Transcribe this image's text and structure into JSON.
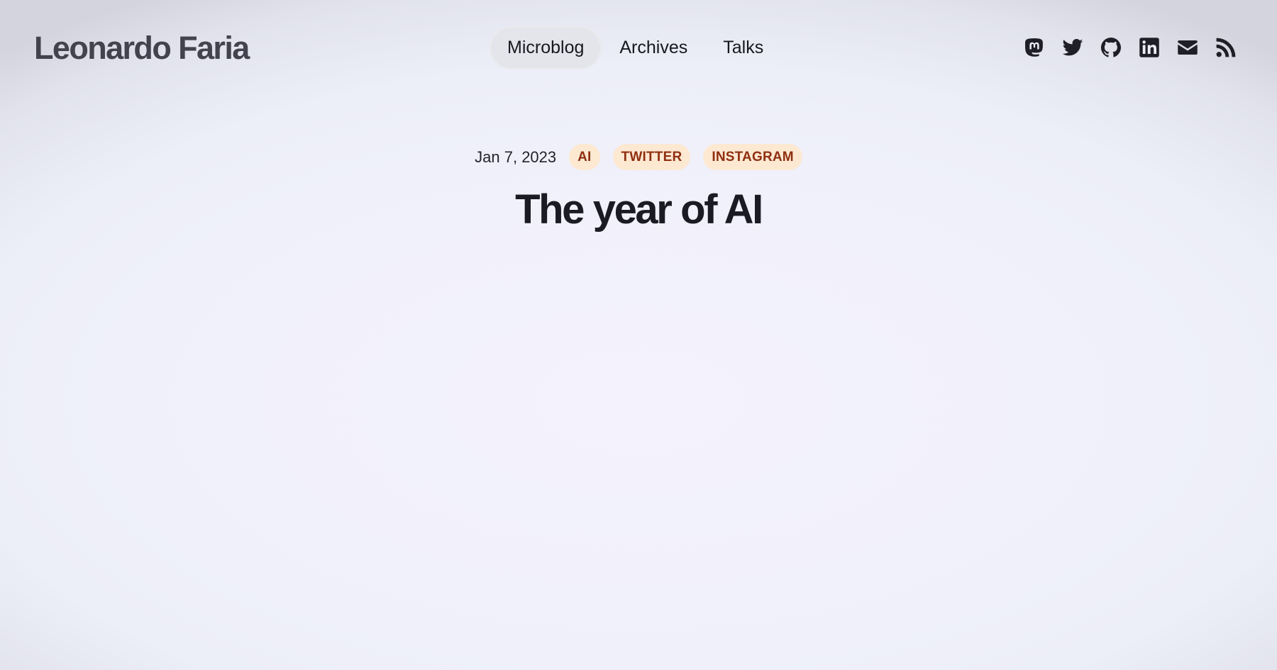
{
  "header": {
    "site_title": "Leonardo Faria",
    "nav": [
      {
        "label": "Microblog",
        "active": true
      },
      {
        "label": "Archives",
        "active": false
      },
      {
        "label": "Talks",
        "active": false
      }
    ],
    "social_icons": [
      "mastodon-icon",
      "twitter-icon",
      "github-icon",
      "linkedin-icon",
      "email-icon",
      "rss-icon"
    ]
  },
  "post": {
    "date": "Jan 7, 2023",
    "tags": [
      "AI",
      "TWITTER",
      "INSTAGRAM"
    ],
    "title": "The year of AI"
  },
  "colors": {
    "tag_background": "#fde8d2",
    "tag_text": "#8f2f10",
    "active_nav_background": "#e4e5ea",
    "icon_color": "#1f1f27"
  }
}
